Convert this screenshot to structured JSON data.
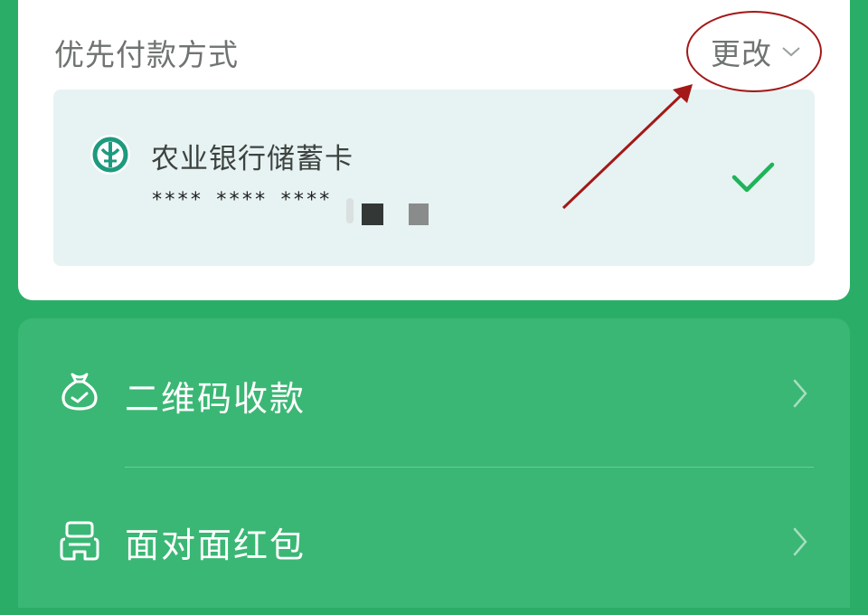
{
  "payment": {
    "section_title": "优先付款方式",
    "change_label": "更改",
    "bank_name": "农业银行储蓄卡",
    "card_number": "**** **** **** "
  },
  "menu": {
    "items": [
      {
        "label": "二维码收款",
        "icon": "money-bag-icon"
      },
      {
        "label": "面对面红包",
        "icon": "red-packet-icon"
      }
    ]
  },
  "colors": {
    "background_green": "#2aae67",
    "panel_green": "#3ab774",
    "check_green": "#20b35a",
    "annotation_red": "#a31818"
  }
}
